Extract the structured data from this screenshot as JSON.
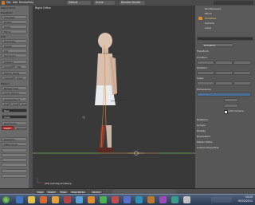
{
  "topbar": {
    "menu_items": [
      "File",
      "Add",
      "Render",
      "Help"
    ],
    "layout_label": "Default",
    "scene_label": "Scene",
    "engine_label": "Blender Render"
  },
  "viewport": {
    "title": "Right Ortho",
    "bottom_text": "(24) Cell Rig Armature"
  },
  "shelf": {
    "sections": [
      "Object Tools",
      "Transform",
      "Edit",
      "History"
    ],
    "buttons": [
      "Translate",
      "Rotate",
      "Scale",
      "Mirror",
      "Duplicate",
      "Delete",
      "Join",
      "Set Origin",
      "Shading",
      "Smooth",
      "Flat",
      "Motion Paths",
      "Calculate",
      "Clear",
      "Repeat Last",
      "Undo History",
      "Grease Pencil",
      "Draw",
      "Line",
      "Erase",
      "New",
      "Snap",
      "Keyframes",
      "Insert",
      "Remove",
      "Relations",
      "Make Local"
    ],
    "active_button": "Insert"
  },
  "outliner": {
    "items": [
      "RenderLayers",
      "World",
      "Armature",
      "Camera",
      "Lamp"
    ]
  },
  "properties": {
    "object_name": "Armature",
    "rows": [
      "Transform",
      "Location:",
      "Rotation:",
      "Scale:",
      "Dimensions:",
      "Relations",
      "Groups",
      "Display",
      "Duplication",
      "Motion Paths",
      "Custom Properties"
    ],
    "checkbox_label": "Lock Camera"
  },
  "viewport_header": {
    "buttons": [
      "View",
      "Select",
      "Pose",
      "Pose Mode",
      "Global"
    ]
  },
  "taskbar": {
    "time": "10:25",
    "date": "05/22/2011"
  },
  "colors": {
    "axis_x": "#c84646",
    "axis_y": "#6ab04c",
    "bone_orange": "#e08a2c",
    "skin": "#d9bfae"
  }
}
